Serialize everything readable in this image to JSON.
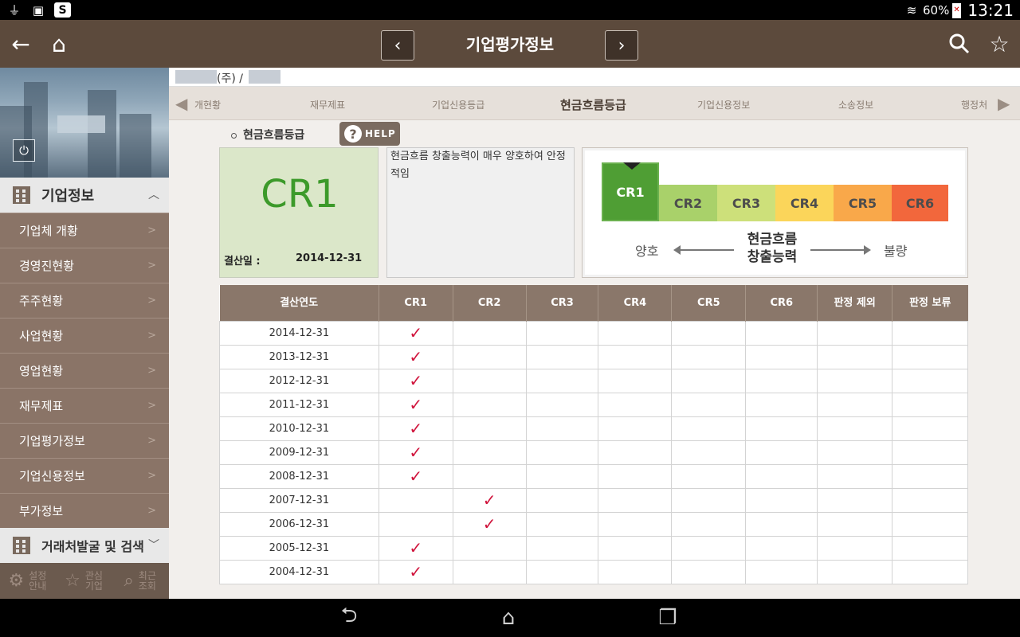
{
  "status_bar": {
    "battery_percent": "60%",
    "time": "13:21",
    "left_icons": [
      "usb-icon",
      "image-icon",
      "s-app-icon"
    ]
  },
  "app_bar": {
    "title": "기업평가정보",
    "prev_label": "‹",
    "next_label": "›"
  },
  "sidebar": {
    "section1_label": "기업정보",
    "items": [
      {
        "label": "기업체 개황"
      },
      {
        "label": "경영진현황"
      },
      {
        "label": "주주현황"
      },
      {
        "label": "사업현황"
      },
      {
        "label": "영업현황"
      },
      {
        "label": "재무제표"
      },
      {
        "label": "기업평가정보"
      },
      {
        "label": "기업신용정보"
      },
      {
        "label": "부가정보"
      }
    ],
    "section2_label": "거래처발굴 및 검색",
    "tools": [
      {
        "label": "설정 안내"
      },
      {
        "label": "관심 기업"
      },
      {
        "label": "최근 조회"
      }
    ]
  },
  "company": {
    "name_text": "(주) /"
  },
  "tabs": [
    {
      "label": "개현황"
    },
    {
      "label": "재무제표"
    },
    {
      "label": "기업신용등급"
    },
    {
      "label": "현금흐름등급"
    },
    {
      "label": "기업신용정보"
    },
    {
      "label": "소송정보"
    },
    {
      "label": "행정처"
    }
  ],
  "section": {
    "title": "현금흐름등급",
    "help_label": "HELP"
  },
  "grade": {
    "value": "CR1",
    "date_label": "결산일 :",
    "date_value": "2014-12-31",
    "description": "현금흐름 창출능력이 매우 양호하여 안정적임"
  },
  "scale": {
    "labels": [
      "CR1",
      "CR2",
      "CR3",
      "CR4",
      "CR5",
      "CR6"
    ],
    "colors": [
      "#4f9e34",
      "#a9d16a",
      "#cde07a",
      "#fbd55a",
      "#f9a84a",
      "#f2673c"
    ],
    "active_index": 0,
    "good_label": "양호",
    "bad_label": "불량",
    "center_line1": "현금흐름",
    "center_line2": "창출능력"
  },
  "table": {
    "headers": [
      "결산연도",
      "CR1",
      "CR2",
      "CR3",
      "CR4",
      "CR5",
      "CR6",
      "판정 제외",
      "판정 보류"
    ],
    "check_mark": "✓",
    "rows": [
      {
        "year": "2014-12-31",
        "grade_col": 1
      },
      {
        "year": "2013-12-31",
        "grade_col": 1
      },
      {
        "year": "2012-12-31",
        "grade_col": 1
      },
      {
        "year": "2011-12-31",
        "grade_col": 1
      },
      {
        "year": "2010-12-31",
        "grade_col": 1
      },
      {
        "year": "2009-12-31",
        "grade_col": 1
      },
      {
        "year": "2008-12-31",
        "grade_col": 1
      },
      {
        "year": "2007-12-31",
        "grade_col": 2
      },
      {
        "year": "2006-12-31",
        "grade_col": 2
      },
      {
        "year": "2005-12-31",
        "grade_col": 1
      },
      {
        "year": "2004-12-31",
        "grade_col": 1
      }
    ]
  }
}
